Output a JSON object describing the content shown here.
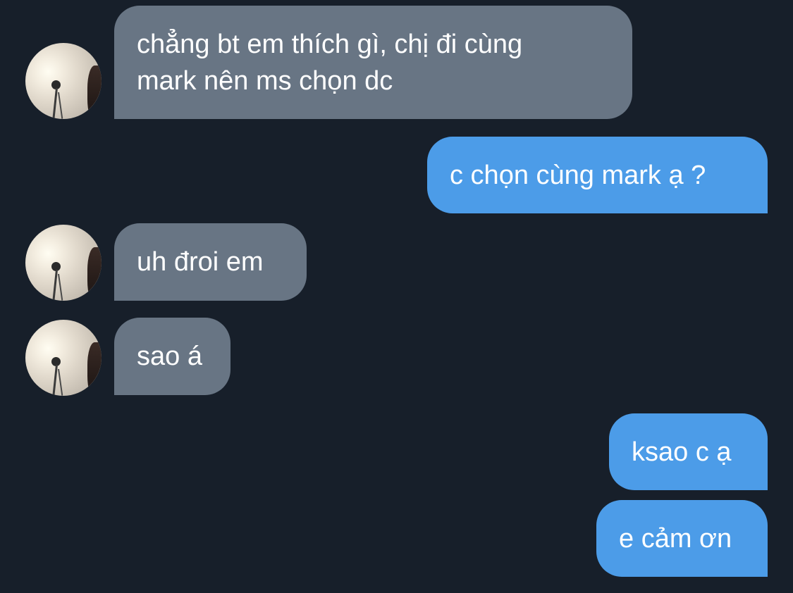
{
  "messages": [
    {
      "direction": "incoming",
      "text": "chẳng bt em thích gì, chị đi cùng\nmark nên ms chọn dc"
    },
    {
      "direction": "outgoing",
      "text": "c chọn cùng mark ạ ?"
    },
    {
      "direction": "incoming",
      "text": "uh đroi em"
    },
    {
      "direction": "incoming",
      "text": "sao á"
    },
    {
      "direction": "outgoing",
      "text": "ksao c ạ"
    },
    {
      "direction": "outgoing",
      "text": "e cảm ơn"
    }
  ],
  "colors": {
    "background": "#171f2a",
    "incoming_bubble": "#687584",
    "outgoing_bubble": "#4c9ce8",
    "text": "#ffffff"
  },
  "icons": {
    "contact_avatar": "avatar-photo-lamp"
  }
}
